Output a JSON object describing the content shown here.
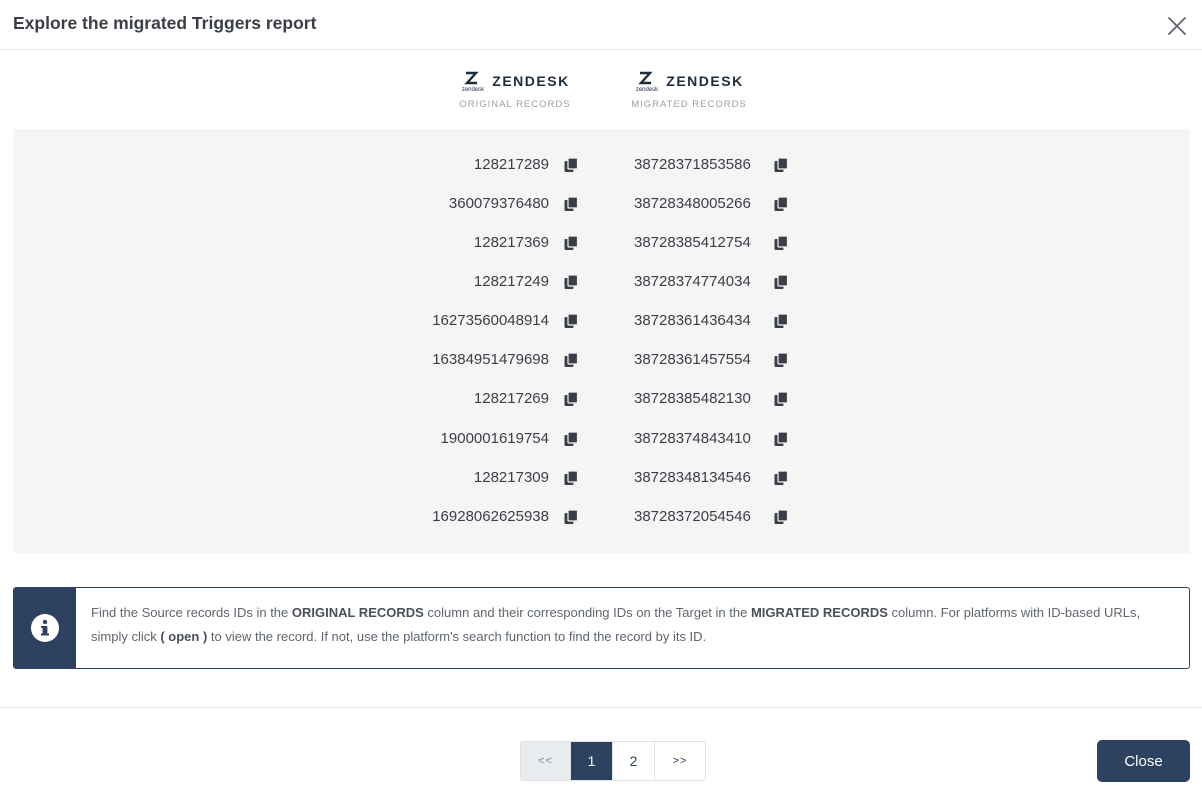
{
  "modal": {
    "title": "Explore the migrated Triggers report",
    "close_icon": "close-icon"
  },
  "columns": {
    "original": {
      "brand": "ZENDESK",
      "logo_sub": "zendesk",
      "caption": "ORIGINAL RECORDS"
    },
    "migrated": {
      "brand": "ZENDESK",
      "logo_sub": "zendesk",
      "caption": "MIGRATED RECORDS"
    }
  },
  "records": [
    {
      "original": "128217289",
      "migrated": "38728371853586"
    },
    {
      "original": "360079376480",
      "migrated": "38728348005266"
    },
    {
      "original": "128217369",
      "migrated": "38728385412754"
    },
    {
      "original": "128217249",
      "migrated": "38728374774034"
    },
    {
      "original": "16273560048914",
      "migrated": "38728361436434"
    },
    {
      "original": "16384951479698",
      "migrated": "38728361457554"
    },
    {
      "original": "128217269",
      "migrated": "38728385482130"
    },
    {
      "original": "1900001619754",
      "migrated": "38728374843410"
    },
    {
      "original": "128217309",
      "migrated": "38728348134546"
    },
    {
      "original": "16928062625938",
      "migrated": "38728372054546"
    }
  ],
  "info": {
    "icon": "info-icon",
    "text_1": "Find the Source records IDs in the ",
    "bold_1": "ORIGINAL RECORDS",
    "text_2": " column and their corresponding IDs on the Target in the ",
    "bold_2": "MIGRATED RECORDS",
    "text_3": " column. For platforms with ID-based URLs, simply click ",
    "bold_3": "( open )",
    "text_4": " to view the record. If not, use the platform's search function to find the record by its ID."
  },
  "pagination": {
    "prev_label": "<<",
    "pages": [
      "1",
      "2"
    ],
    "active_page": "1",
    "next_label": ">>"
  },
  "footer": {
    "close_label": "Close"
  },
  "colors": {
    "primary": "#2c4260",
    "panel_bg": "#f5f5f5"
  }
}
